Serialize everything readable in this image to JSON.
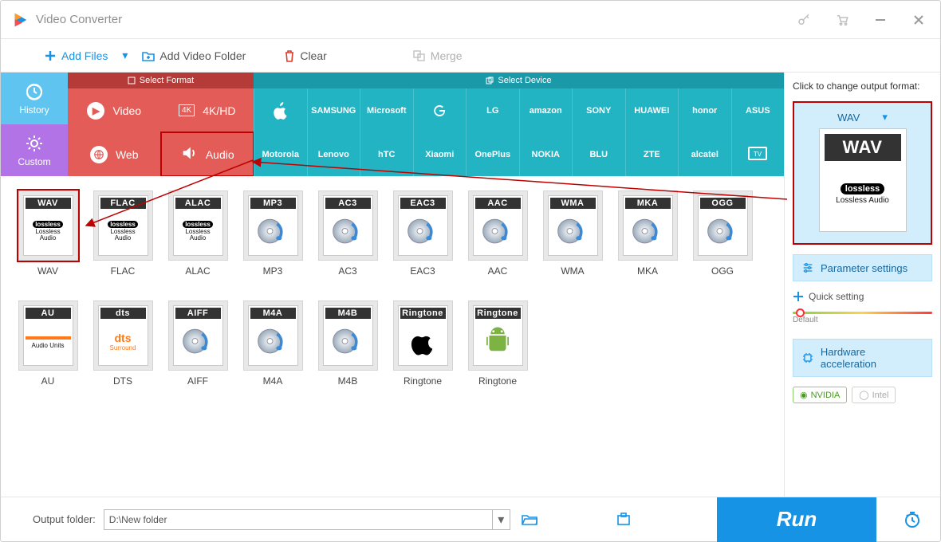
{
  "window": {
    "title": "Video Converter"
  },
  "toolbar": {
    "add_files": "Add Files",
    "add_folder": "Add Video Folder",
    "clear": "Clear",
    "merge": "Merge"
  },
  "left_cats": {
    "history": "History",
    "custom": "Custom"
  },
  "format_header": "Select Format",
  "device_header": "Select Device",
  "format_cells": {
    "video": "Video",
    "fourk": "4K/HD",
    "web": "Web",
    "audio": "Audio"
  },
  "device_brands_row1": [
    "Apple",
    "SAMSUNG",
    "Microsoft",
    "Google",
    "LG",
    "amazon",
    "SONY",
    "HUAWEI",
    "honor",
    "ASUS"
  ],
  "device_brands_row2": [
    "Motorola",
    "Lenovo",
    "hTC",
    "Xiaomi",
    "OnePlus",
    "NOKIA",
    "BLU",
    "ZTE",
    "alcatel",
    "TV"
  ],
  "tiles_row1": [
    {
      "code": "WAV",
      "label": "WAV",
      "sub": "lossless",
      "selected": true
    },
    {
      "code": "FLAC",
      "label": "FLAC",
      "sub": "lossless"
    },
    {
      "code": "ALAC",
      "label": "ALAC",
      "sub": "lossless"
    },
    {
      "code": "MP3",
      "label": "MP3"
    },
    {
      "code": "AC3",
      "label": "AC3"
    },
    {
      "code": "EAC3",
      "label": "EAC3"
    },
    {
      "code": "AAC",
      "label": "AAC"
    },
    {
      "code": "WMA",
      "label": "WMA"
    },
    {
      "code": "MKA",
      "label": "MKA"
    },
    {
      "code": "OGG",
      "label": "OGG"
    }
  ],
  "tiles_row2": [
    {
      "code": "AU",
      "label": "AU",
      "sub": "au"
    },
    {
      "code": "dts",
      "label": "DTS",
      "sub": "dts"
    },
    {
      "code": "AIFF",
      "label": "AIFF"
    },
    {
      "code": "M4A",
      "label": "M4A"
    },
    {
      "code": "M4B",
      "label": "M4B"
    },
    {
      "code": "Ringtone",
      "label": "Ringtone",
      "sub": "apple"
    },
    {
      "code": "Ringtone",
      "label": "Ringtone",
      "sub": "android"
    }
  ],
  "rightpanel": {
    "title": "Click to change output format:",
    "selected_code": "WAV",
    "selected_sub1": "lossless",
    "selected_sub2": "Lossless Audio",
    "parameter_settings": "Parameter settings",
    "quick_setting": "Quick setting",
    "slider_label": "Default",
    "hardware_accel": "Hardware acceleration",
    "nvidia": "NVIDIA",
    "intel": "Intel"
  },
  "footer": {
    "label": "Output folder:",
    "path": "D:\\New folder",
    "run": "Run"
  }
}
